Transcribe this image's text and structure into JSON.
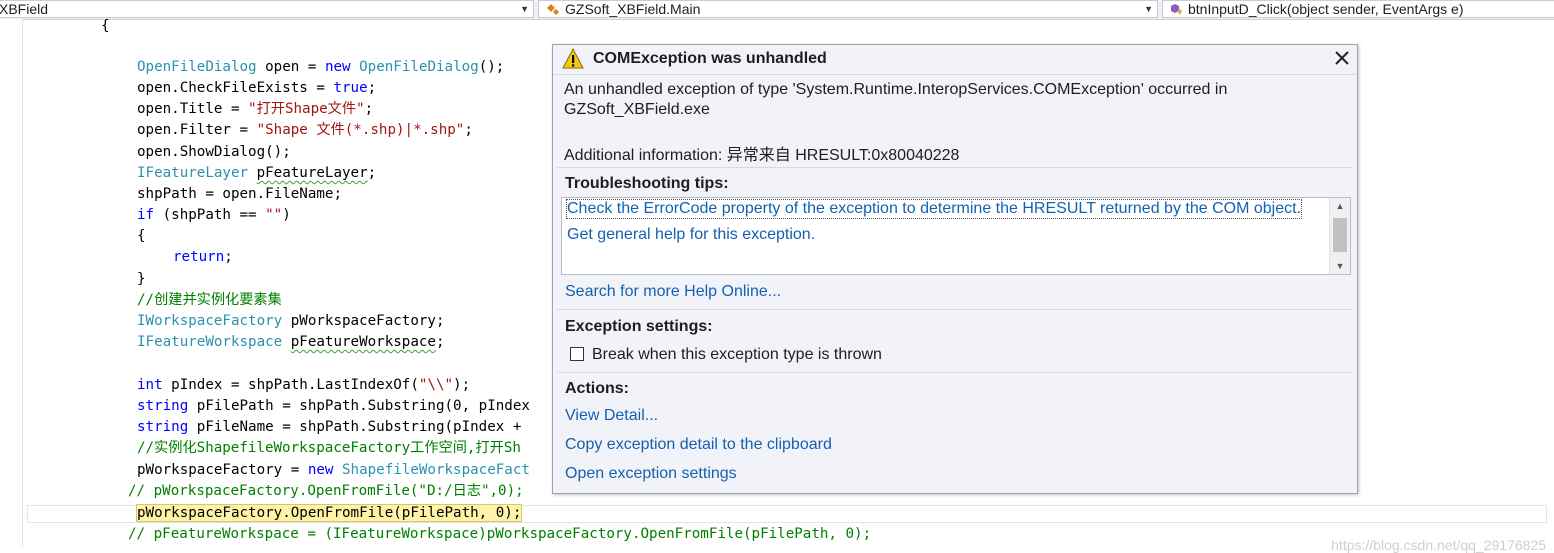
{
  "navbar": {
    "project": "XBField",
    "type": "GZSoft_XBField.Main",
    "member": "btnInputD_Click(object sender, EventArgs e)"
  },
  "code": {
    "brace_open": "{",
    "l1_a": "OpenFileDialog",
    "l1_b": " open = ",
    "l1_c": "new",
    "l1_d": " ",
    "l1_e": "OpenFileDialog",
    "l1_f": "();",
    "l2_a": "open.CheckFileExists = ",
    "l2_b": "true",
    "l2_c": ";",
    "l3_a": "open.Title = ",
    "l3_b": "\"打开Shape文件\"",
    "l3_c": ";",
    "l4_a": "open.Filter = ",
    "l4_b": "\"Shape 文件(*.shp)|*.shp\"",
    "l4_c": ";",
    "l5": "open.ShowDialog();",
    "l6_a": "IFeatureLayer",
    "l6_b": " ",
    "l6_c": "pFeatureLayer",
    "l6_d": ";",
    "l7": "shpPath = open.FileName;",
    "l8_a": "if",
    "l8_b": " (shpPath == ",
    "l8_c": "\"\"",
    "l8_d": ")",
    "l9": "{",
    "l10_a": "return",
    "l10_b": ";",
    "l11": "}",
    "l12": "//创建并实例化要素集",
    "l13_a": "IWorkspaceFactory",
    "l13_b": " pWorkspaceFactory;",
    "l14_a": "IFeatureWorkspace",
    "l14_b": " ",
    "l14_c": "pFeatureWorkspace",
    "l14_d": ";",
    "l16_a": "int",
    "l16_b": " pIndex = shpPath.LastIndexOf(",
    "l16_c": "\"\\\\\"",
    "l16_d": ");",
    "l17_a": "string",
    "l17_b": " pFilePath = shpPath.Substring(0, pIndex",
    "l18_a": "string",
    "l18_b": " pFileName = shpPath.Substring(pIndex +",
    "l19": "//实例化ShapefileWorkspaceFactory工作空间,打开Sh",
    "l20_a": "pWorkspaceFactory = ",
    "l20_b": "new",
    "l20_c": " ",
    "l20_d": "ShapefileWorkspaceFact",
    "l21": "// pWorkspaceFactory.OpenFromFile(\"D:/日志\",0);",
    "l22": "pWorkspaceFactory.OpenFromFile(pFilePath, 0);",
    "l23": "// pFeatureWorkspace = (IFeatureWorkspace)pWorkspaceFactory.OpenFromFile(pFilePath, 0);"
  },
  "exception": {
    "title": "COMException was unhandled",
    "message_line1": "An unhandled exception of type 'System.Runtime.InteropServices.COMException' occurred in",
    "message_line2": "GZSoft_XBField.exe",
    "additional": "Additional information: 异常来自 HRESULT:0x80040228",
    "tips_header": "Troubleshooting tips:",
    "tip1": "Check the ErrorCode property of the exception to determine the HRESULT returned by the COM object.",
    "tip2": "Get general help for this exception.",
    "search_online": "Search for more Help Online...",
    "settings_header": "Exception settings:",
    "break_label": "Break when this exception type is thrown",
    "actions_header": "Actions:",
    "action1": "View Detail...",
    "action2": "Copy exception detail to the clipboard",
    "action3": "Open exception settings"
  },
  "watermark": "https://blog.csdn.net/qq_29176825",
  "colors": {
    "keyword": "#0000ff",
    "type": "#2b91af",
    "string": "#a31515",
    "comment": "#008000",
    "link": "#1560b0",
    "highlight": "#fff3a8"
  }
}
